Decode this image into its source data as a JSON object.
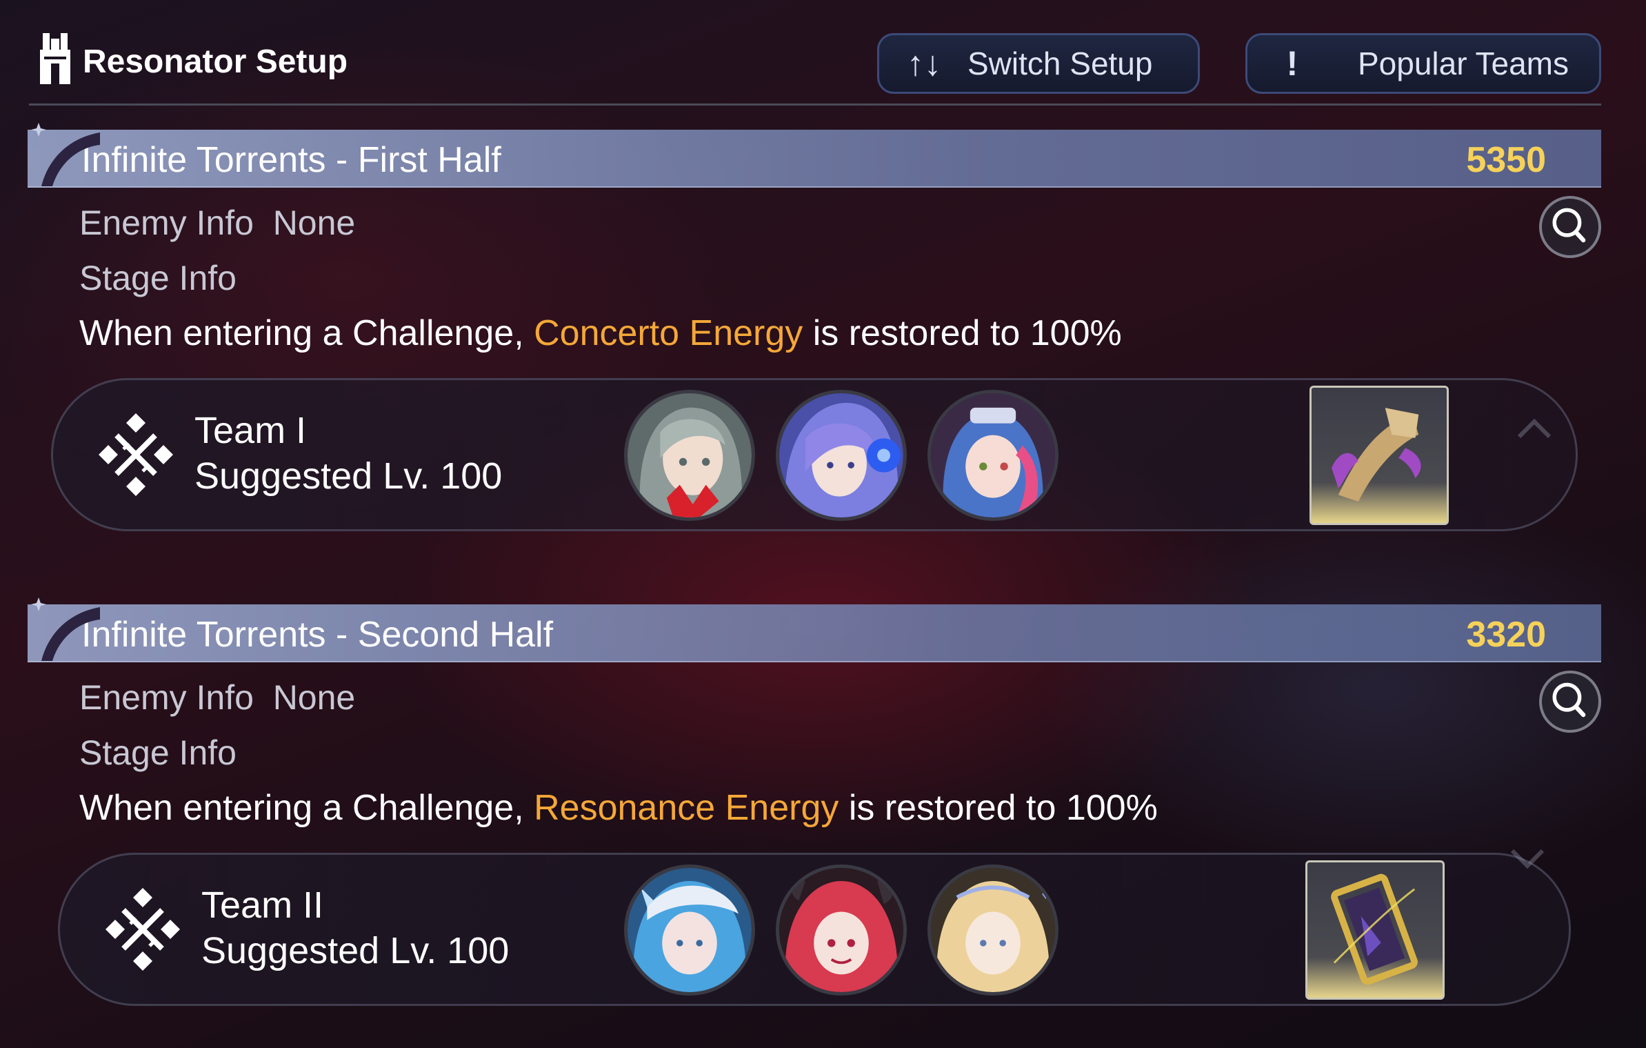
{
  "header": {
    "title": "Resonator Setup",
    "switch_label": "Switch Setup",
    "switch_icon": "↑↓",
    "popular_label": "Popular Teams",
    "popular_icon": "!"
  },
  "sections": [
    {
      "name": "Infinite Torrents - First Half",
      "score": "5350",
      "enemy_label": "Enemy Info",
      "enemy_value": "None",
      "stage_label": "Stage Info",
      "desc_prefix": "When entering a Challenge, ",
      "desc_highlight": "Concerto Energy",
      "desc_suffix": " is restored to 100%",
      "team_name": "Team I",
      "team_level": "Suggested Lv. 100"
    },
    {
      "name": "Infinite Torrents - Second Half",
      "score": "3320",
      "enemy_label": "Enemy Info",
      "enemy_value": "None",
      "stage_label": "Stage Info",
      "desc_prefix": "When entering a Challenge, ",
      "desc_highlight": "Resonance Energy",
      "desc_suffix": " is restored to 100%",
      "team_name": "Team II",
      "team_level": "Suggested Lv. 100"
    }
  ],
  "colors": {
    "highlight": "#f5a838",
    "score": "#f6d25a"
  }
}
